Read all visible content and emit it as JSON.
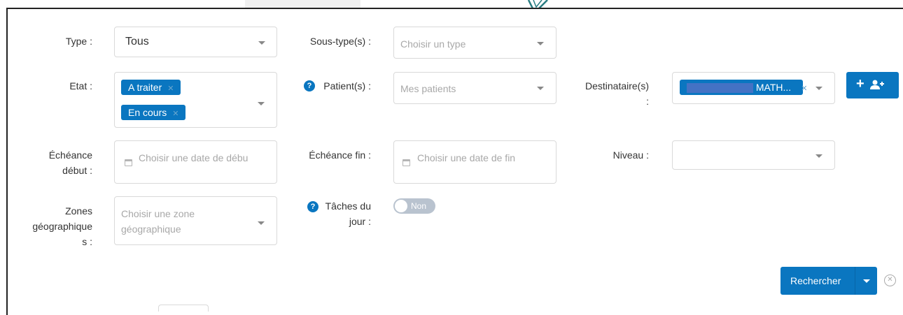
{
  "filters": {
    "type": {
      "label": "Type :",
      "value": "Tous"
    },
    "sous_type": {
      "label": "Sous-type(s) :",
      "placeholder": "Choisir un type"
    },
    "etat": {
      "label": "Etat :",
      "tags": [
        "A traiter",
        "En cours"
      ]
    },
    "patient": {
      "label": "Patient(s) :",
      "placeholder": "Mes patients"
    },
    "destinataire": {
      "label_line1": "Destinataire(s)",
      "label_line2": ":",
      "tag": "MATH..."
    },
    "echeance_debut": {
      "label_line1": "Échéance",
      "label_line2": "début :",
      "placeholder": "Choisir une date de débu"
    },
    "echeance_fin": {
      "label": "Échéance fin :",
      "placeholder": "Choisir une date de fin"
    },
    "niveau": {
      "label": "Niveau :"
    },
    "zones": {
      "label_line1": "Zones",
      "label_line2": "géographique",
      "label_line3": "s :",
      "placeholder_line1": "Choisir une zone",
      "placeholder_line2": "géographique"
    },
    "taches": {
      "label_line1": "Tâches du",
      "label_line2": "jour :",
      "toggle_text": "Non"
    }
  },
  "actions": {
    "search_label": "Rechercher",
    "add_recipient_label": "+"
  },
  "colors": {
    "primary": "#0a76c0",
    "border": "#d9d9d9",
    "placeholder": "#a8a8a8"
  },
  "icons": [
    "chevron-down-icon",
    "help-icon",
    "calendar-icon",
    "add-user-icon",
    "close-circle-icon",
    "tag-remove-icon"
  ]
}
